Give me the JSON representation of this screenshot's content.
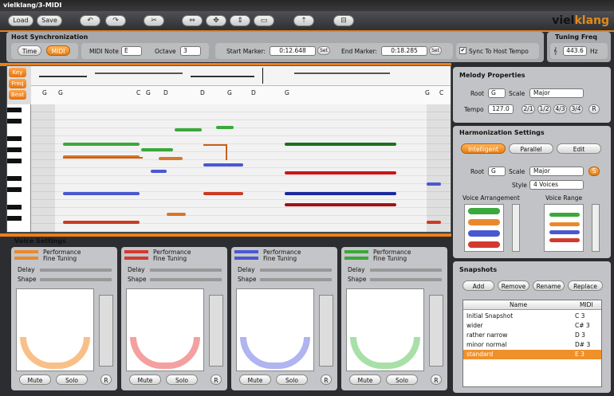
{
  "title": "vielklang/3-MIDI",
  "toolbar": {
    "load": "Load",
    "save": "Save",
    "logo_a": "viel",
    "logo_b": "klang"
  },
  "host": {
    "title": "Host Synchronization",
    "time": "Time",
    "midi": "MIDI",
    "midi_note_label": "MIDI Note",
    "midi_note": "E",
    "octave_label": "Octave",
    "octave": "3",
    "start_label": "Start Marker:",
    "start": "0:12.648",
    "set": "Set",
    "end_label": "End Marker:",
    "end": "0:18.285",
    "sync": "Sync To Host Tempo"
  },
  "tuning": {
    "title": "Tuning Freq",
    "value": "443.6",
    "unit": "Hz"
  },
  "side": {
    "key": "Key",
    "freq": "Freq",
    "beat": "Beat"
  },
  "chords": [
    "|",
    "G",
    "G",
    "C",
    "G",
    "D",
    "D",
    "G",
    "D",
    "G",
    "G",
    "C"
  ],
  "melody": {
    "title": "Melody Properties",
    "root_label": "Root",
    "root": "G",
    "scale_label": "Scale",
    "scale": "Major",
    "tempo_label": "Tempo",
    "tempo": "127.0",
    "b1": "2/1",
    "b2": "1/2",
    "b3": "4/3",
    "b4": "3/4",
    "r": "R"
  },
  "harm": {
    "title": "Harmonization Settings",
    "intelligent": "Intelligent",
    "parallel": "Parallel",
    "edit": "Edit",
    "root_label": "Root",
    "root": "G",
    "scale_label": "Scale",
    "scale": "Major",
    "s": "S",
    "style_label": "Style",
    "style": "4 Voices",
    "voice_arr": "Voice Arrangement",
    "voice_range": "Voice Range"
  },
  "voice_settings": {
    "title": "Voice Settings",
    "perf": "Performance",
    "fine": "Fine Tuning",
    "delay": "Delay",
    "shape": "Shape",
    "min": "0",
    "max": "100",
    "mute": "Mute",
    "solo": "Solo",
    "r": "R",
    "colors": [
      "#e88a2c",
      "#d23a30",
      "#4a58d0",
      "#3aa83a"
    ]
  },
  "snapshots": {
    "title": "Snapshots",
    "add": "Add",
    "remove": "Remove",
    "rename": "Rename",
    "replace": "Replace",
    "col_name": "Name",
    "col_midi": "MIDI",
    "rows": [
      {
        "name": "Initial Snapshot",
        "midi": "C 3"
      },
      {
        "name": "wider",
        "midi": "C# 3"
      },
      {
        "name": "rather narrow",
        "midi": "D 3"
      },
      {
        "name": "minor normal",
        "midi": "D# 3"
      },
      {
        "name": "standard",
        "midi": "E 3"
      }
    ]
  }
}
